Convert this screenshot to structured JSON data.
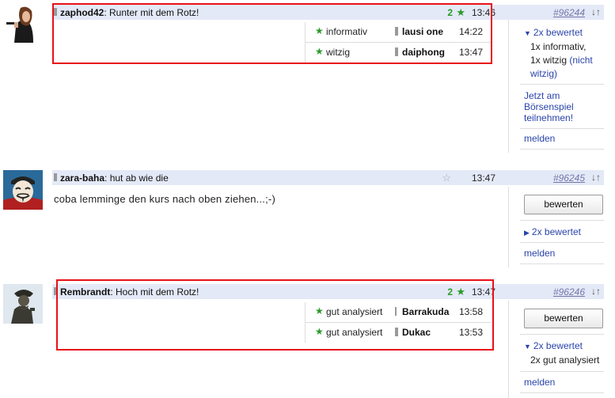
{
  "posts": [
    {
      "author": "zaphod42",
      "title": "Runter mit dem Rotz!",
      "count": "2",
      "time": "13:46",
      "post_id": "#96244",
      "ratings": [
        {
          "label": "informativ",
          "user": "lausi one",
          "time": "14:22"
        },
        {
          "label": "witzig",
          "user": "daiphong",
          "time": "13:47"
        }
      ],
      "side_toggle": "2x bewertet",
      "side_detail_1": "1x informativ,",
      "side_detail_2": "1x witzig",
      "side_detail_2_link": "(nicht",
      "side_detail_3": "witzig)",
      "promo_1": "Jetzt am",
      "promo_2": "Börsenspiel",
      "promo_3": "teilnehmen!",
      "report": "melden"
    },
    {
      "author": "zara-baha",
      "title": "hut ab wie die",
      "time": "13:47",
      "post_id": "#96245",
      "body": "coba lemminge den kurs nach oben ziehen...;-)",
      "rate_button": "bewerten",
      "side_toggle": "2x bewertet",
      "report": "melden"
    },
    {
      "author": "Rembrandt",
      "title": "Hoch mit dem Rotz!",
      "count": "2",
      "time": "13:47",
      "post_id": "#96246",
      "ratings": [
        {
          "label": "gut analysiert",
          "user": "Barrakuda",
          "time": "13:58"
        },
        {
          "label": "gut analysiert",
          "user": "Dukac",
          "time": "13:53"
        }
      ],
      "rate_button": "bewerten",
      "side_toggle": "2x bewertet",
      "side_detail_1": "2x gut analysiert",
      "report": "melden"
    }
  ],
  "icons": {
    "star_filled": "green-star-icon",
    "star_empty": "empty-star-icon",
    "sort": "sort-arrows-icon",
    "expand": "triangle-toggle-icon"
  },
  "colors": {
    "header_bg": "#e4e9f7",
    "highlight_border": "#e8101a",
    "star_green": "#2a9a2a",
    "link_blue": "#2a44aa"
  }
}
